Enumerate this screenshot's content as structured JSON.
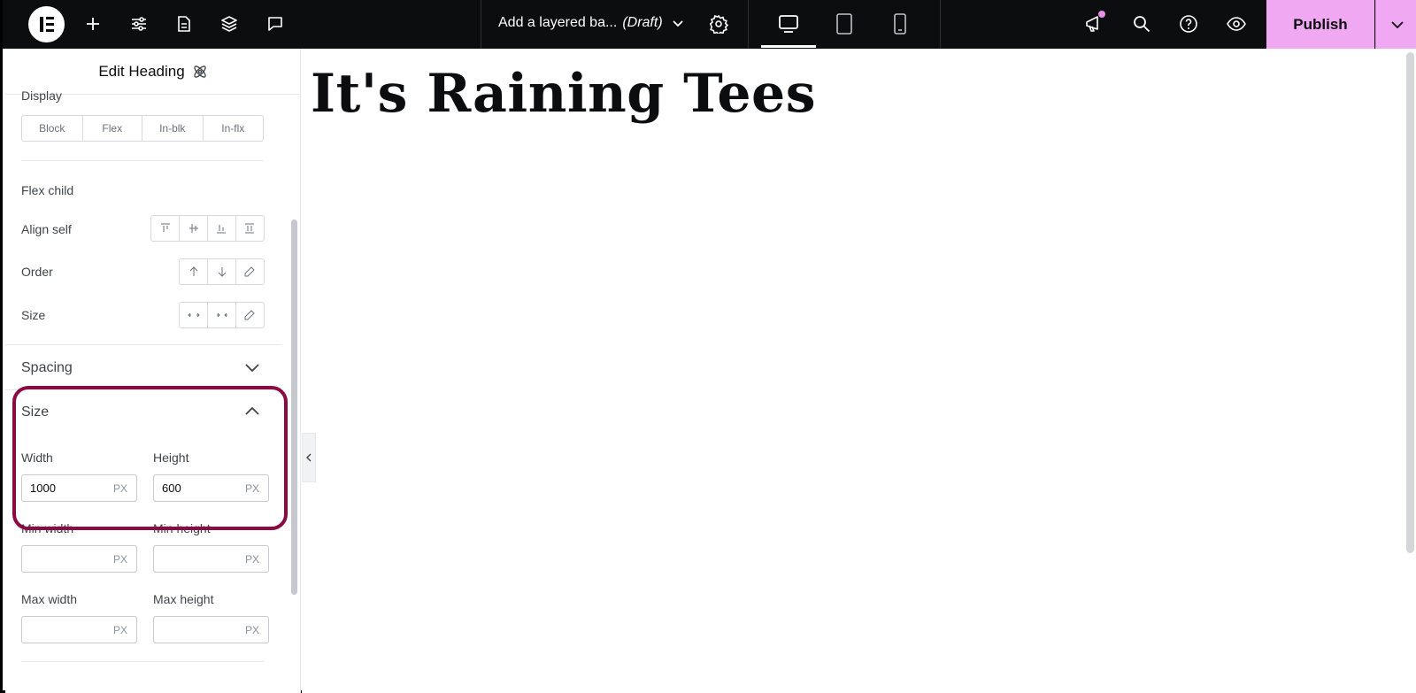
{
  "topbar": {
    "document_title": "Add a layered ba...",
    "document_status": "(Draft)",
    "publish_label": "Publish",
    "icons": [
      "elementor-logo-icon",
      "plus-icon",
      "sliders-icon",
      "page-icon",
      "layers-icon",
      "chat-icon",
      "chevron-down-icon",
      "gear-icon",
      "desktop-icon",
      "tablet-icon",
      "mobile-icon",
      "megaphone-icon",
      "search-icon",
      "help-icon",
      "eye-icon",
      "chevron-down-icon"
    ],
    "accent_color": "#f0a8f2"
  },
  "panel": {
    "header_title": "Edit Heading",
    "display_label": "Display",
    "display_options": [
      "Block",
      "Flex",
      "In-blk",
      "In-flx"
    ],
    "flex_child_title": "Flex child",
    "align_self_label": "Align self",
    "order_label": "Order",
    "size_flex_label": "Size",
    "spacing_title": "Spacing",
    "size_section": {
      "title": "Size",
      "width_label": "Width",
      "width_value": "1000",
      "width_unit": "PX",
      "height_label": "Height",
      "height_value": "600",
      "height_unit": "PX",
      "min_width_label": "Min width",
      "min_width_unit": "PX",
      "min_height_label": "Min height",
      "min_height_unit": "PX",
      "max_width_label": "Max width",
      "max_width_unit": "PX",
      "max_height_label": "Max height",
      "max_height_unit": "PX"
    },
    "highlight_color": "#8a0a42"
  },
  "canvas": {
    "heading_text": "It's Raining Tees"
  }
}
